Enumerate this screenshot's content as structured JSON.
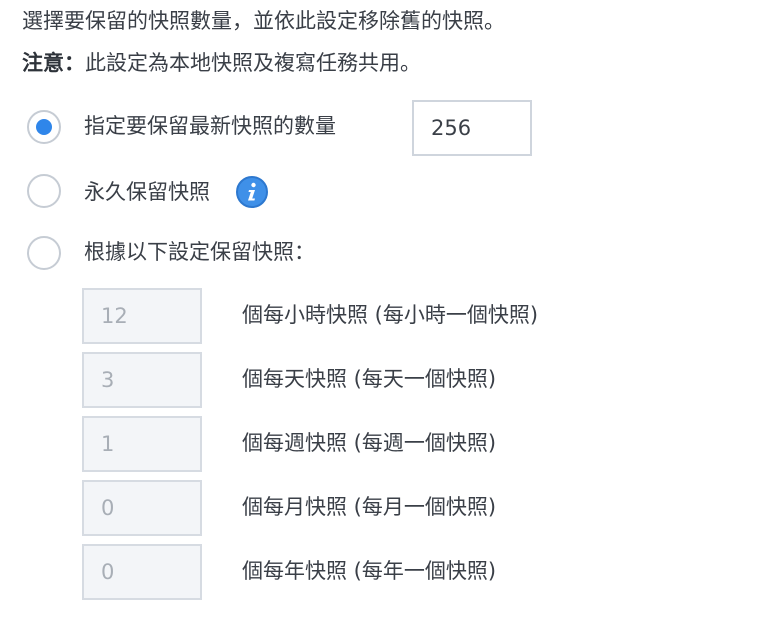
{
  "intro_text": "選擇要保留的快照數量，並依此設定移除舊的快照。",
  "note": {
    "label": "注意",
    "separator": "：",
    "text": "此設定為本地快照及複寫任務共用。"
  },
  "options": {
    "keep_latest": {
      "label": "指定要保留最新快照的數量",
      "value": "256",
      "selected": true
    },
    "keep_forever": {
      "label": "永久保留快照",
      "selected": false,
      "icon": "info-icon"
    },
    "by_schedule": {
      "label": "根據以下設定保留快照：",
      "selected": false
    }
  },
  "schedule_rows": [
    {
      "value": "12",
      "label": "個每小時快照 (每小時一個快照)"
    },
    {
      "value": "3",
      "label": "個每天快照 (每天一個快照)"
    },
    {
      "value": "1",
      "label": "個每週快照 (每週一個快照)"
    },
    {
      "value": "0",
      "label": "個每月快照 (每月一個快照)"
    },
    {
      "value": "0",
      "label": "個每年快照 (每年一個快照)"
    }
  ],
  "colors": {
    "accent": "#2f86ea",
    "info_icon": "#3f90e8",
    "text": "#3a3f47",
    "border": "#cfd5dd",
    "disabled_bg": "#f3f5f8",
    "disabled_text": "#a8aeb6"
  }
}
